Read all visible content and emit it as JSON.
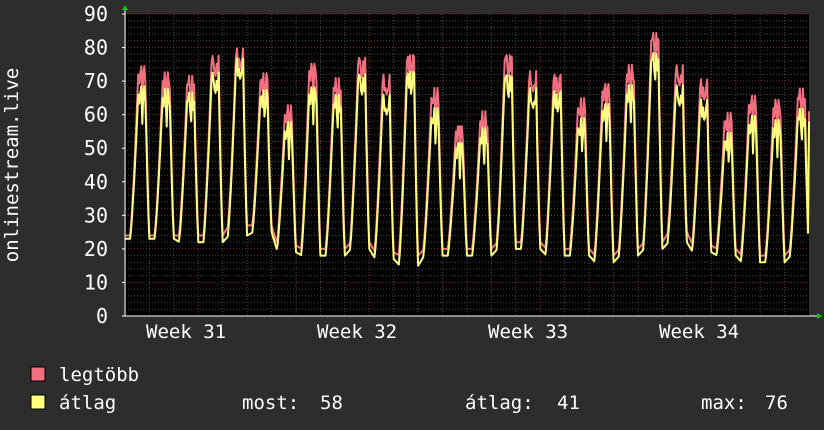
{
  "chart_data": {
    "type": "line",
    "ylabel": "onlinestream.live",
    "ylim": [
      0,
      90
    ],
    "yticks": [
      0,
      10,
      20,
      30,
      40,
      50,
      60,
      70,
      80,
      90
    ],
    "x_tick_labels": [
      "Week 31",
      "Week 32",
      "Week 33",
      "Week 34"
    ],
    "grid": true,
    "legend_position": "bottom-left",
    "background": "#2d2d2d",
    "plot_background": "#000000",
    "grid_color": "#4a4a4a",
    "major_grid_color": "#7a2a2a",
    "axis_arrow_color": "#00cc00",
    "x_unit": "day index from plot start (28 days)",
    "series": [
      {
        "name": "legtöbb",
        "color": "#f07080",
        "daily": [
          {
            "min": 24,
            "max": 72
          },
          {
            "min": 24,
            "max": 70
          },
          {
            "min": 24,
            "max": 69
          },
          {
            "min": 24,
            "max": 75
          },
          {
            "min": 27,
            "max": 77
          },
          {
            "min": 27,
            "max": 70
          },
          {
            "min": 21,
            "max": 60
          },
          {
            "min": 20,
            "max": 73
          },
          {
            "min": 20,
            "max": 68
          },
          {
            "min": 22,
            "max": 75
          },
          {
            "min": 19,
            "max": 69
          },
          {
            "min": 18,
            "max": 76
          },
          {
            "min": 20,
            "max": 65
          },
          {
            "min": 20,
            "max": 55
          },
          {
            "min": 20,
            "max": 58
          },
          {
            "min": 22,
            "max": 76
          },
          {
            "min": 22,
            "max": 70
          },
          {
            "min": 20,
            "max": 70
          },
          {
            "min": 20,
            "max": 62
          },
          {
            "min": 18,
            "max": 67
          },
          {
            "min": 20,
            "max": 72
          },
          {
            "min": 22,
            "max": 82
          },
          {
            "min": 25,
            "max": 72
          },
          {
            "min": 21,
            "max": 68
          },
          {
            "min": 20,
            "max": 58
          },
          {
            "min": 18,
            "max": 63
          },
          {
            "min": 18,
            "max": 62
          },
          {
            "min": 20,
            "max": 65
          }
        ],
        "end": 61
      },
      {
        "name": "átlag",
        "color": "#ffff80",
        "daily": [
          {
            "min": 23,
            "max": 66
          },
          {
            "min": 23,
            "max": 65
          },
          {
            "min": 22,
            "max": 64
          },
          {
            "min": 22,
            "max": 70
          },
          {
            "min": 24,
            "max": 74
          },
          {
            "min": 25,
            "max": 65
          },
          {
            "min": 19,
            "max": 55
          },
          {
            "min": 18,
            "max": 66
          },
          {
            "min": 18,
            "max": 63
          },
          {
            "min": 20,
            "max": 70
          },
          {
            "min": 17,
            "max": 63
          },
          {
            "min": 15,
            "max": 71
          },
          {
            "min": 18,
            "max": 59
          },
          {
            "min": 18,
            "max": 50
          },
          {
            "min": 18,
            "max": 53
          },
          {
            "min": 20,
            "max": 70
          },
          {
            "min": 20,
            "max": 65
          },
          {
            "min": 18,
            "max": 65
          },
          {
            "min": 18,
            "max": 56
          },
          {
            "min": 16,
            "max": 61
          },
          {
            "min": 18,
            "max": 66
          },
          {
            "min": 20,
            "max": 76
          },
          {
            "min": 22,
            "max": 66
          },
          {
            "min": 19,
            "max": 62
          },
          {
            "min": 18,
            "max": 52
          },
          {
            "min": 16,
            "max": 57
          },
          {
            "min": 16,
            "max": 56
          },
          {
            "min": 18,
            "max": 59
          }
        ],
        "end": 58
      }
    ]
  },
  "legend": {
    "items": [
      {
        "label": "legtöbb",
        "color": "#f07080"
      },
      {
        "label": "átlag",
        "color": "#ffff80"
      }
    ],
    "stats": [
      {
        "label": "most:",
        "value": "58"
      },
      {
        "label": "átlag:",
        "value": "41"
      },
      {
        "label": "max:",
        "value": "76"
      }
    ]
  }
}
